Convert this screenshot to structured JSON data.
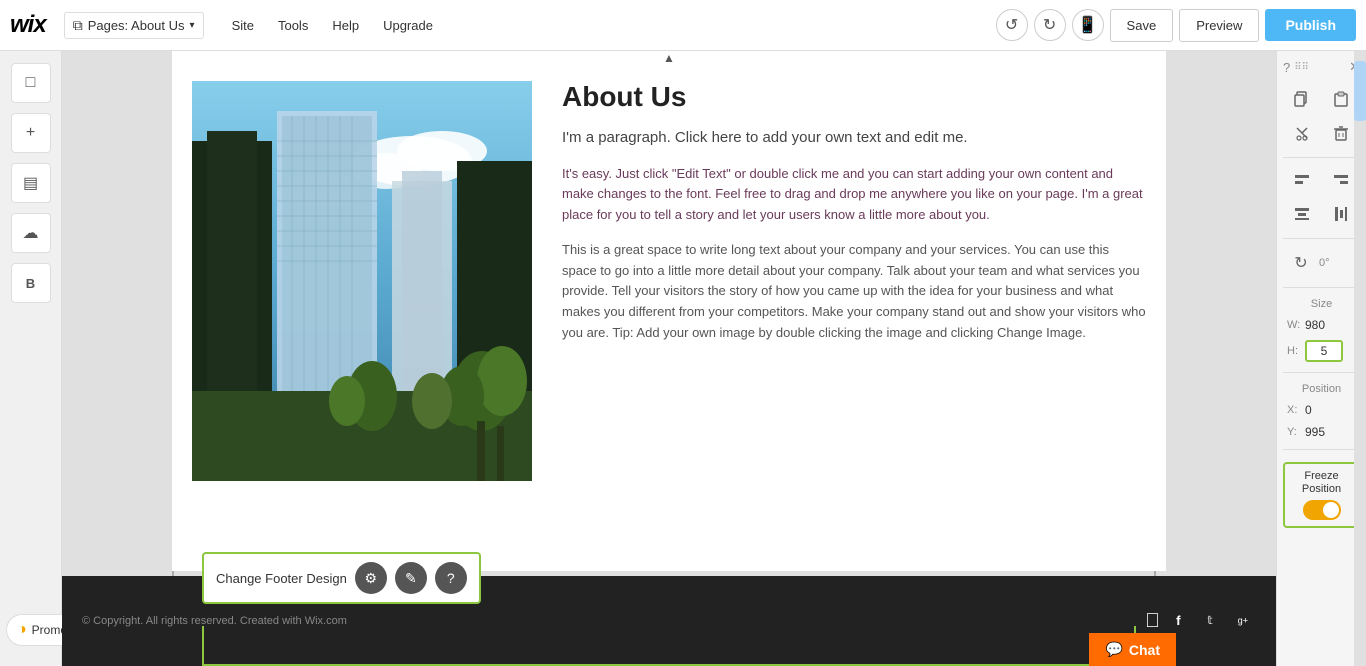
{
  "topbar": {
    "wix_logo": "wix",
    "pages_btn_label": "Pages: About Us",
    "chevron": "▾",
    "nav_site": "Site",
    "nav_tools": "Tools",
    "nav_help": "Help",
    "nav_upgrade": "Upgrade",
    "save_label": "Save",
    "preview_label": "Preview",
    "publish_label": "Publish"
  },
  "sidebar": {
    "icons": [
      "□",
      "+",
      "▤",
      "☁",
      "B"
    ],
    "promote_label": "Promote",
    "promote_icon": "◑"
  },
  "about": {
    "title": "About Us",
    "subtitle": "I'm a paragraph. Click here to add your own text and edit me.",
    "para1": "It's easy. Just click \"Edit Text\" or double click me and you can start adding your own content and make changes to the font. Feel free to drag and drop me anywhere you like on your page. I'm a great place for you to tell a story and let your users know a little more about you.",
    "para2": "This is a great space to write long text about your company and your services. You can use this space to go into a little more detail about your company. Talk about your team and what services you provide. Tell your visitors the story of how you came up with the idea for your business and what makes you different from your competitors. Make your company stand out and show your visitors who you are. Tip: Add your own image by double clicking the image and clicking Change Image."
  },
  "footer": {
    "left_text": "© Copyright. All rights reserved. Created with Wix.com",
    "social_facebook": "f",
    "social_twitter": "t",
    "social_gplus": "g+"
  },
  "footer_popup": {
    "label": "Change Footer Design",
    "icon_gear": "⚙",
    "icon_edit": "✎",
    "icon_question": "?"
  },
  "right_panel": {
    "question_mark": "?",
    "grid_icon": "⠿",
    "close_icon": "✕",
    "copy_icon": "⧉",
    "paste_icon": "⧉",
    "cut_icon": "✂",
    "delete_icon": "🗑",
    "align_left_icon": "⬛",
    "align_right_icon": "⬛",
    "align_center_h": "⬛",
    "align_center_v": "⬛",
    "rotate_icon": "↻",
    "rotate_value": "0°",
    "size_label": "Size",
    "width_label": "W:",
    "width_value": "980",
    "height_label": "H:",
    "height_value": "5",
    "position_label": "Position",
    "x_label": "X:",
    "x_value": "0",
    "y_label": "Y:",
    "y_value": "995",
    "freeze_label": "Freeze\nPosition"
  },
  "chat_btn": {
    "label": "Chat",
    "icon": "💬"
  },
  "colors": {
    "publish_bg": "#4eb7f5",
    "accent_green": "#8dc63f",
    "toggle_bg": "#f0a500",
    "footer_bg": "#222222",
    "chat_bg": "#ff6b00"
  }
}
